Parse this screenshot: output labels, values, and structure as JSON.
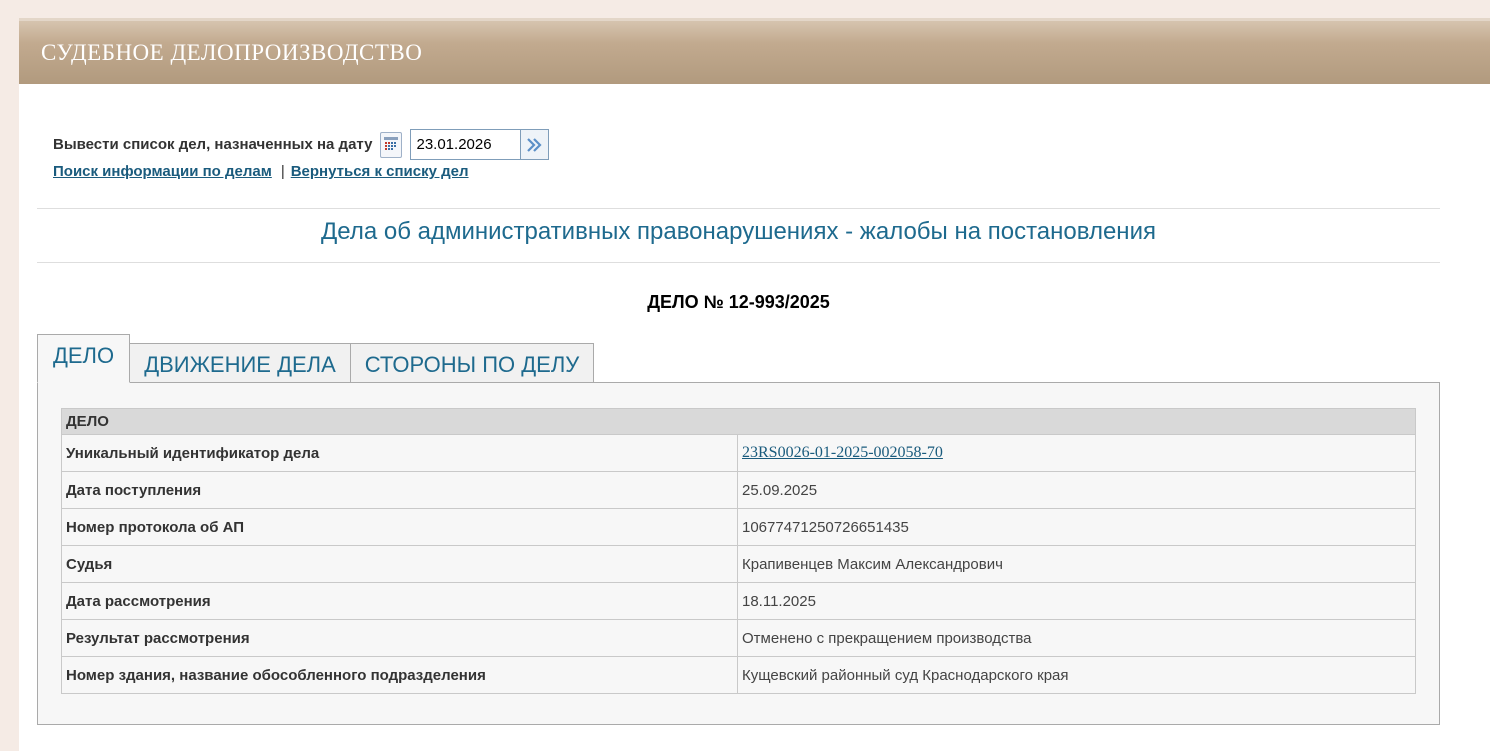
{
  "header": {
    "title": "СУДЕБНОЕ ДЕЛОПРОИЗВОДСТВО"
  },
  "datebar": {
    "label": "Вывести список дел, назначенных на дату",
    "date_value": "23.01.2026",
    "calendar_icon": "calendar-icon",
    "go_icon": "double-chevron-right-icon"
  },
  "links": {
    "search": "Поиск информации по делам",
    "separator": "|",
    "back": "Вернуться к списку дел"
  },
  "section_title": "Дела об административных правонарушениях - жалобы на постановления",
  "case_number": "ДЕЛО № 12-993/2025",
  "tabs": [
    {
      "label": "ДЕЛО",
      "active": true
    },
    {
      "label": "ДВИЖЕНИЕ ДЕЛА",
      "active": false
    },
    {
      "label": "СТОРОНЫ ПО ДЕЛУ",
      "active": false
    }
  ],
  "table": {
    "header": "ДЕЛО",
    "rows": [
      {
        "label": "Уникальный идентификатор дела",
        "value": "23RS0026-01-2025-002058-70"
      },
      {
        "label": "Дата поступления",
        "value": "25.09.2025"
      },
      {
        "label": "Номер протокола об АП",
        "value": "10677471250726651435"
      },
      {
        "label": "Судья",
        "value": "Крапивенцев Максим Александрович"
      },
      {
        "label": "Дата рассмотрения",
        "value": "18.11.2025"
      },
      {
        "label": "Результат рассмотрения",
        "value": "Отменено с прекращением производства"
      },
      {
        "label": "Номер здания, название обособленного подразделения",
        "value": "Кущевский районный суд Краснодарского края"
      }
    ]
  },
  "colors": {
    "header_gradient": "#c2aa8f",
    "page_bg": "#f5ebe5",
    "link": "#1a5b7d",
    "accent_title": "#1e6a8e"
  }
}
